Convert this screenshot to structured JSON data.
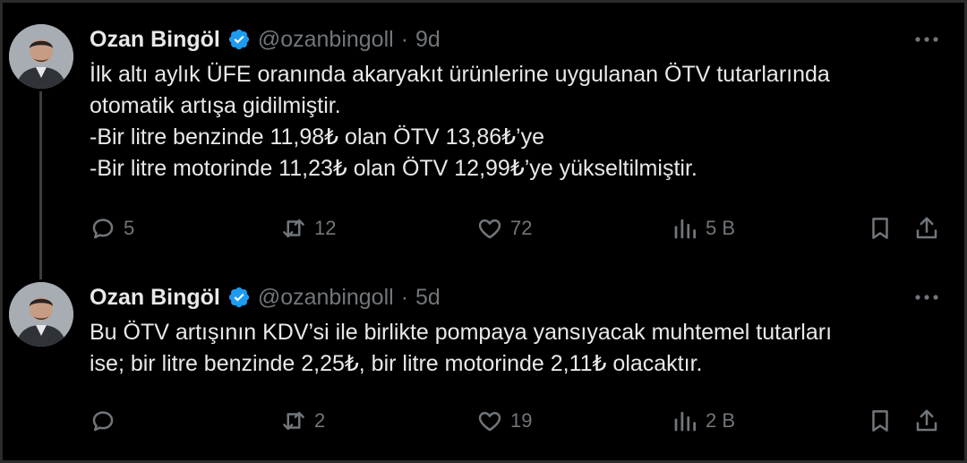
{
  "colors": {
    "background": "#000000",
    "text": "#e7e9ea",
    "muted": "#71767b",
    "verified": "#1d9bf0"
  },
  "tweets": [
    {
      "author": "Ozan Bingöl",
      "handle": "@ozanbingoll",
      "separator": "·",
      "time": "9d",
      "lines": [
        "İlk altı aylık ÜFE oranında akaryakıt ürünlerine uygulanan ÖTV tutarlarında",
        "otomatik artışa gidilmiştir.",
        "-Bir litre benzinde 11,98₺ olan ÖTV 13,86₺’ye",
        "-Bir litre motorinde 11,23₺ olan ÖTV 12,99₺’ye yükseltilmiştir."
      ],
      "replies": "5",
      "retweets": "12",
      "likes": "72",
      "views": "5 B"
    },
    {
      "author": "Ozan Bingöl",
      "handle": "@ozanbingoll",
      "separator": "·",
      "time": "5d",
      "lines": [
        "Bu ÖTV artışının KDV’si ile birlikte pompaya yansıyacak muhtemel tutarları",
        "ise; bir litre benzinde 2,25₺, bir litre motorinde 2,11₺ olacaktır."
      ],
      "replies": "",
      "retweets": "2",
      "likes": "19",
      "views": "2 B"
    }
  ]
}
